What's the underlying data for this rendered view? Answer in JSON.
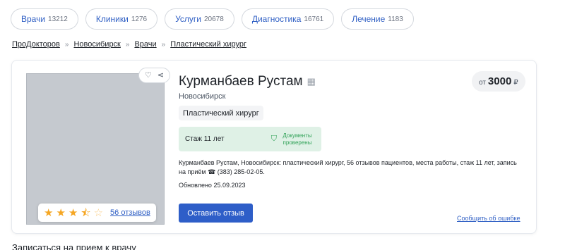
{
  "chips": [
    {
      "label": "Врачи",
      "count": "13212"
    },
    {
      "label": "Клиники",
      "count": "1276"
    },
    {
      "label": "Услуги",
      "count": "20678"
    },
    {
      "label": "Диагностика",
      "count": "16761"
    },
    {
      "label": "Лечение",
      "count": "1183"
    }
  ],
  "breadcrumb": {
    "items": [
      "ПроДокторов",
      "Новосибирск",
      "Врачи",
      "Пластический хирург"
    ],
    "separator": "»"
  },
  "doctor": {
    "name": "Курманбаев Рустам",
    "city": "Новосибирск",
    "specialty": "Пластический хирург",
    "experience": "Стаж 11 лет",
    "docs_verified": "Документы проверены",
    "description": "Курманбаев Рустам, Новосибирск: пластический хирург, 56 отзывов пациентов, места работы, стаж 11 лет, запись на приём ☎ (383) 285-02-05.",
    "updated": "Обновлено 25.09.2023"
  },
  "rating": {
    "value": 3.5,
    "max": 5,
    "reviews_link": "56 отзывов"
  },
  "price": {
    "prefix": "от",
    "value": "3000",
    "currency": "₽"
  },
  "actions": {
    "review_button": "Оставить отзыв",
    "report_error": "Сообщить об ошибке"
  },
  "section_title": "Записаться на прием к врачу",
  "icons": {
    "favorite": "heart-icon",
    "share": "share-icon",
    "verified": "shield-check-icon",
    "badge": "certificate-icon"
  },
  "colors": {
    "link": "#2f5fc4",
    "button": "#2e5ec8",
    "star": "#f5a623",
    "verified_bg": "#dff1e6",
    "verified_text": "#33a35a"
  }
}
